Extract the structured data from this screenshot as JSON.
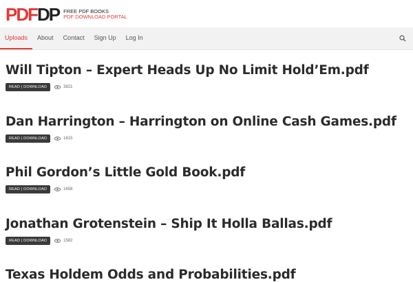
{
  "brand": {
    "mark_red": "PDF",
    "mark_dark": "DP",
    "tagline1": "FREE PDF BOOKS",
    "tagline2": "PDF DOWNLOAD PORTAL"
  },
  "nav": {
    "items": [
      {
        "label": "Uploads",
        "active": true
      },
      {
        "label": "About"
      },
      {
        "label": "Contact"
      },
      {
        "label": "Sign Up"
      },
      {
        "label": "Log In"
      }
    ],
    "search_icon": "search-icon"
  },
  "posts": [
    {
      "title": "Will Tipton – Expert Heads Up No Limit Hold’Em.pdf",
      "button": "READ | DOWNLOAD",
      "views": "3821"
    },
    {
      "title": "Dan Harrington – Harrington on Online Cash Games.pdf",
      "button": "READ | DOWNLOAD",
      "views": "1615"
    },
    {
      "title": "Phil Gordon’s Little Gold Book.pdf",
      "button": "READ | DOWNLOAD",
      "views": "1658"
    },
    {
      "title": "Jonathan Grotenstein – Ship It Holla Ballas.pdf",
      "button": "READ | DOWNLOAD",
      "views": "1582"
    },
    {
      "title": "Texas Holdem Odds and Probabilities.pdf",
      "button": "READ | DOWNLOAD",
      "views": ""
    }
  ],
  "colors": {
    "accent": "#e53935",
    "button_bg": "#3a3a3a",
    "nav_bg": "#f2f2f2"
  }
}
